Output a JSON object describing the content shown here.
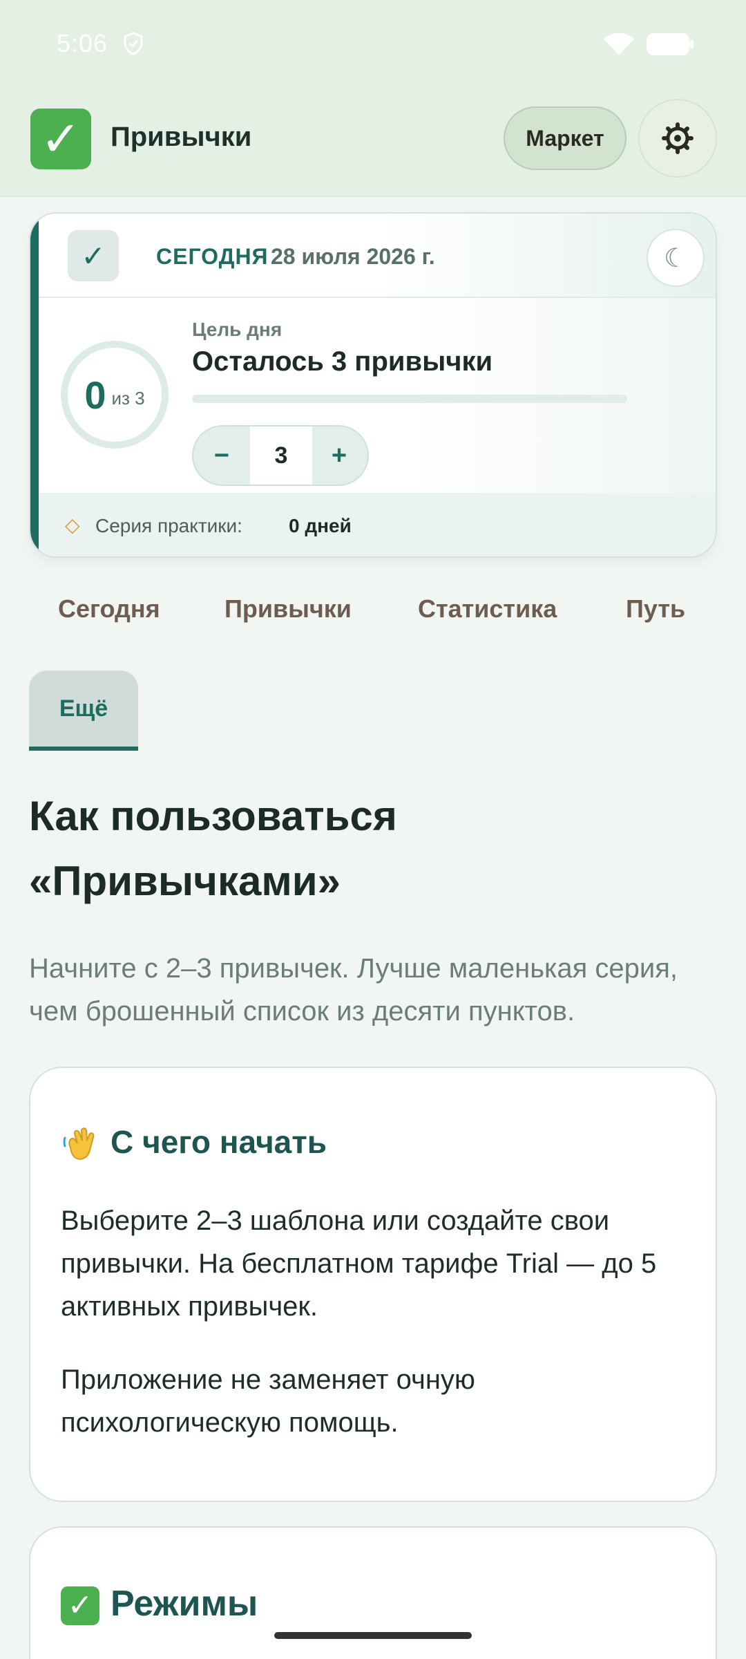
{
  "status_bar": {
    "time": "5:06"
  },
  "app_bar": {
    "title": "Привычки",
    "market_label": "Маркет"
  },
  "today_card": {
    "label": "СЕГОДНЯ",
    "date": "28 июля 2026 г.",
    "done_count": "0",
    "of_total": "из 3",
    "goal_caption": "Цель дня",
    "goal_text": "Осталось 3 привычки",
    "goal_progress": 0,
    "stepper_value": "3",
    "stepper_minus": "−",
    "stepper_plus": "+",
    "streak_label": "Серия практики:",
    "streak_value": "0 дней"
  },
  "tabs": [
    {
      "label": "Сегодня"
    },
    {
      "label": "Привычки"
    },
    {
      "label": "Статистика"
    },
    {
      "label": "Путь"
    },
    {
      "label": "Ещё",
      "active": true
    }
  ],
  "main": {
    "heading": "Как пользоваться «Привычками»",
    "lead": "Начните с 2–3 привычек. Лучше маленькая серия, чем брошенный список из десяти пунктов."
  },
  "cards": [
    {
      "title": "С чего начать",
      "icon": "waving-hand-icon",
      "paragraphs": [
        "Выберите 2–3 шаблона или создайте свои привычки. На бесплатном тарифе Trial — до 5 активных привычек.",
        "Приложение не заменяет очную психологическую помощь."
      ]
    },
    {
      "title": "Режимы",
      "icon": "check-mark-button-icon"
    }
  ],
  "colors": {
    "accent": "#1e6b60",
    "app_bar": "#e4f0e3",
    "background": "#f2f6f3"
  }
}
